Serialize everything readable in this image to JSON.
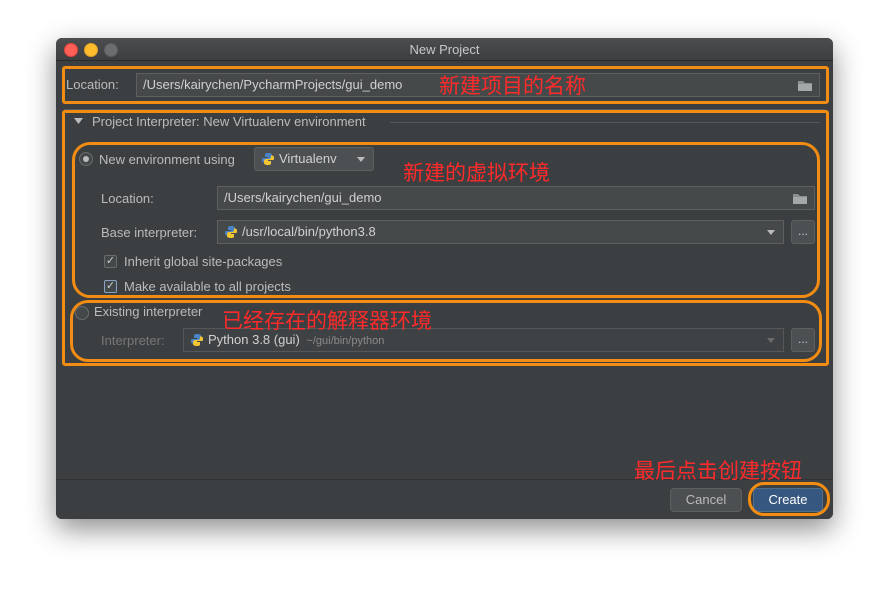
{
  "window": {
    "title": "New Project"
  },
  "project": {
    "location_label": "Location:",
    "location_value": "/Users/kairychen/PycharmProjects/gui_demo"
  },
  "interpreter_section": {
    "header": "Project Interpreter: New Virtualenv environment",
    "new_env": {
      "radio_label": "New environment using",
      "tool_value": "Virtualenv",
      "location_label": "Location:",
      "location_value": "/Users/kairychen/gui_demo",
      "base_label": "Base interpreter:",
      "base_value": "/usr/local/bin/python3.8",
      "inherit_label": "Inherit global site-packages",
      "inherit_checked": true,
      "available_label": "Make available to all projects",
      "available_checked": true
    },
    "existing": {
      "radio_label": "Existing interpreter",
      "interpreter_label": "Interpreter:",
      "interpreter_value": "Python 3.8 (gui)",
      "interpreter_path": "~/gui/bin/python"
    },
    "browse_label": "..."
  },
  "buttons": {
    "cancel": "Cancel",
    "create": "Create"
  },
  "annotations": {
    "project_name": "新建项目的名称",
    "new_env": "新建的虚拟环境",
    "existing": "已经存在的解释器环境",
    "create": "最后点击创建按钮"
  },
  "colors": {
    "window_bg": "#3c3f41",
    "highlight": "#f28c13",
    "annotation": "#ff2a2a",
    "primary_button": "#365880"
  },
  "icons": [
    "close-icon",
    "minimize-icon",
    "maximize-icon",
    "folder-icon",
    "python-icon",
    "dropdown-arrow-icon",
    "checkmark-icon",
    "collapse-triangle-icon"
  ]
}
